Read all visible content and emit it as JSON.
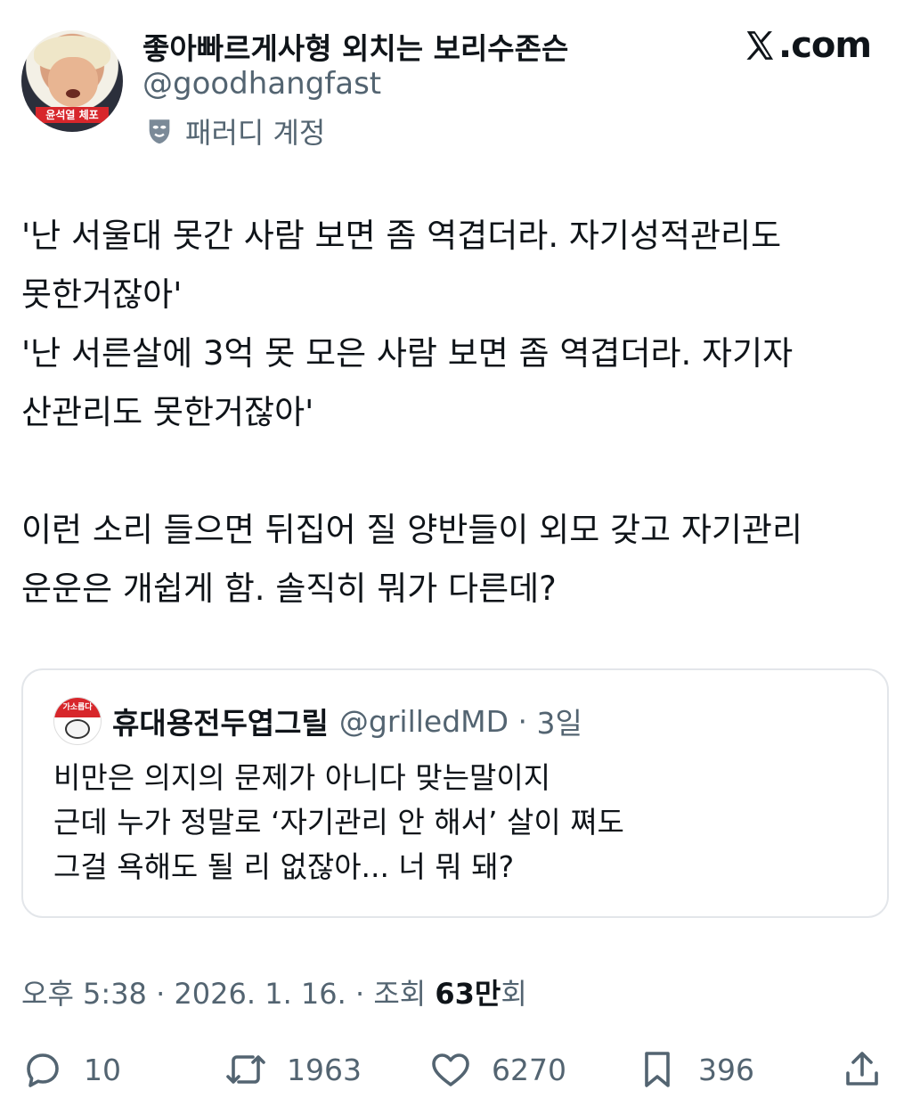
{
  "author": {
    "display_name": "좋아빠르게사형 외치는 보리수존슨",
    "handle": "@goodhangfast",
    "parody_label": "패러디 계정",
    "avatar_banner": "윤석열 체포"
  },
  "brand": {
    "text": ".com",
    "icon": "x-logo-icon"
  },
  "tweet": {
    "text": "'난 서울대 못간 사람 보면 좀 역겹더라. 자기성적관리도\n못한거잖아'\n'난 서른살에 3억 못 모은 사람 보면 좀 역겹더라. 자기자\n산관리도 못한거잖아'\n\n이런 소리 들으면 뒤집어 질 양반들이 외모 갖고 자기관리\n운운은 개쉽게 함. 솔직히 뭐가 다른데?"
  },
  "quote": {
    "avatar_badge": "가소롭다",
    "name": "휴대용전두엽그릴",
    "handle": "@grilledMD",
    "age": "3일",
    "text": "비만은 의지의 문제가 아니다 맞는말이지\n근데 누가 정말로 ‘자기관리 안 해서’ 살이 쪄도\n그걸 욕해도 될 리 없잖아... 너 뭐 돼?"
  },
  "meta": {
    "time": "오후 5:38",
    "date": "2026. 1. 16.",
    "views_label": "조회",
    "views_count": "63만",
    "views_unit": "회"
  },
  "actions": {
    "replies": "10",
    "retweets": "1963",
    "likes": "6270",
    "bookmarks": "396"
  },
  "colors": {
    "text": "#0f1419",
    "secondary": "#536471",
    "border": "#e3e6ea"
  }
}
